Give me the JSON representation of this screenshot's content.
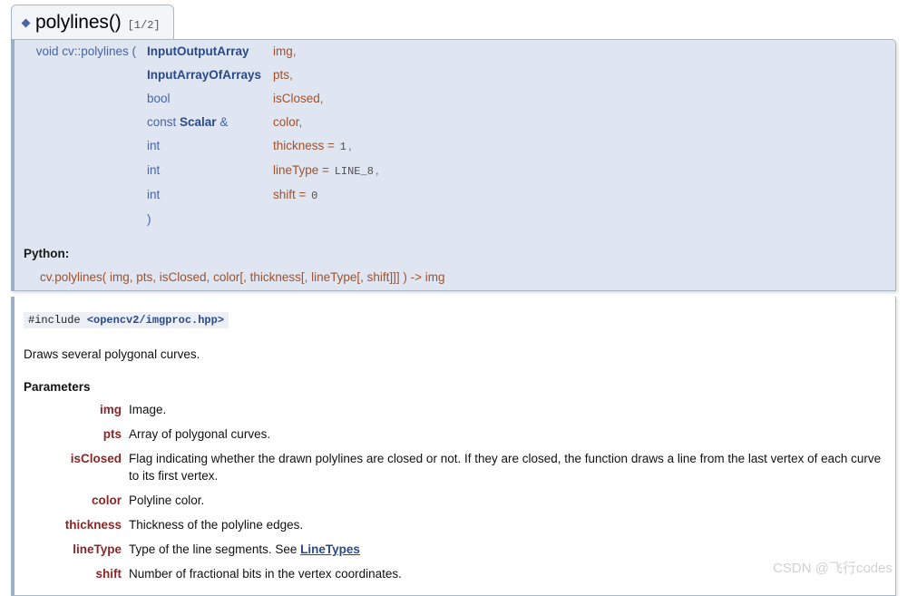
{
  "tab": {
    "bullet_icon": "diamond-icon",
    "title": "polylines()",
    "count": "[1/2]"
  },
  "signature": {
    "return_and_name": "void cv::polylines (",
    "close_paren": ")",
    "params": [
      {
        "type_prefix": "",
        "type": "InputOutputArray",
        "type_suffix": "",
        "name": "img",
        "default_eq": "",
        "default": "",
        "comma": ","
      },
      {
        "type_prefix": "",
        "type": "InputArrayOfArrays",
        "type_suffix": "",
        "name": "pts",
        "default_eq": "",
        "default": "",
        "comma": ","
      },
      {
        "type_prefix": "bool",
        "type": "",
        "type_suffix": "",
        "name": "isClosed",
        "default_eq": "",
        "default": "",
        "comma": ","
      },
      {
        "type_prefix": "const ",
        "type": "Scalar",
        "type_suffix": " &",
        "name": "color",
        "default_eq": "",
        "default": "",
        "comma": ","
      },
      {
        "type_prefix": "int",
        "type": "",
        "type_suffix": "",
        "name": "thickness",
        "default_eq": " = ",
        "default": "1",
        "comma": ","
      },
      {
        "type_prefix": "int",
        "type": "",
        "type_suffix": "",
        "name": "lineType",
        "default_eq": " = ",
        "default": "LINE_8",
        "comma": ","
      },
      {
        "type_prefix": "int",
        "type": "",
        "type_suffix": "",
        "name": "shift",
        "default_eq": " = ",
        "default": "0",
        "comma": ""
      }
    ]
  },
  "python": {
    "label": "Python:",
    "signature": "cv.polylines( img, pts, isClosed, color[, thickness[, lineType[, shift]]] ) -> img"
  },
  "doc": {
    "include_directive": "#include ",
    "include_path": "<opencv2/imgproc.hpp>",
    "brief": "Draws several polygonal curves.",
    "parameters_heading": "Parameters",
    "parameters": [
      {
        "name": "img",
        "desc": "Image.",
        "link": ""
      },
      {
        "name": "pts",
        "desc": "Array of polygonal curves.",
        "link": ""
      },
      {
        "name": "isClosed",
        "desc": "Flag indicating whether the drawn polylines are closed or not. If they are closed, the function draws a line from the last vertex of each curve to its first vertex.",
        "link": ""
      },
      {
        "name": "color",
        "desc": "Polyline color.",
        "link": ""
      },
      {
        "name": "thickness",
        "desc": "Thickness of the polyline edges.",
        "link": ""
      },
      {
        "name": "lineType",
        "desc": "Type of the line segments. See ",
        "link": "LineTypes"
      },
      {
        "name": "shift",
        "desc": "Number of fractional bits in the vertex coordinates.",
        "link": ""
      }
    ]
  },
  "watermark": {
    "text": "CSDN @飞行codes"
  }
}
